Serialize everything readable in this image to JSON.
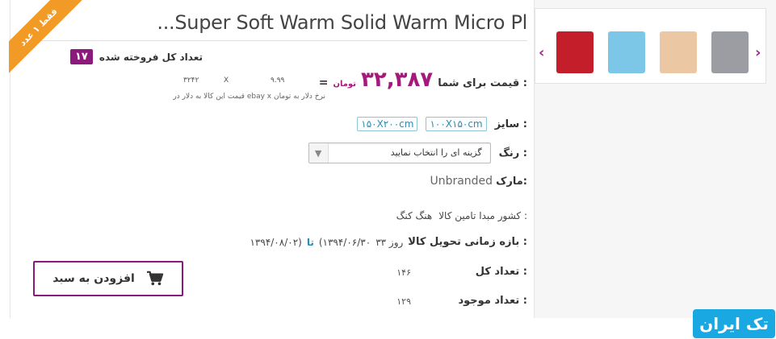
{
  "product": {
    "title": "...Super Soft Warm Solid Warm Micro Pl",
    "ribbon": "فقط ۱ عدد",
    "sold_label": "تعداد کل فروخته شده",
    "sold_count": "۱۷",
    "price_label": "قیمت برای شما :",
    "price_value": "۳۲,۳۸۷",
    "price_unit": "تومان",
    "price_dash": "=",
    "calc_rate": "۳۲۴۲",
    "calc_x": "X",
    "calc_usd": "۹.۹۹",
    "calc_note": "قیمت این کالا به دلار در ebay x نرخ دلار به تومان",
    "size_label": "سایز :",
    "sizes": [
      "۱۰۰X۱۵۰cm",
      "۱۵۰X۲۰۰cm"
    ],
    "color_label": "رنگ :",
    "color_select": "گزینه ای را انتخاب نمایید",
    "brand_label": "مارک:",
    "brand_value": "Unbranded",
    "origin_label": "کشور مبدا تامین کالا :",
    "origin_value": "هنگ کنگ",
    "delivery_label": "بازه زمانی تحویل کالا :",
    "delivery_days": "۳۳ روز",
    "delivery_from": "(۱۳۹۴/۰۶/۳۰",
    "delivery_to_word": "تا",
    "delivery_to": "۱۳۹۴/۰۸/۰۲)",
    "total_label": "تعداد کل :",
    "total_value": "۱۴۶",
    "stock_label": "تعداد موجود :",
    "stock_value": "۱۲۹",
    "cart_label": "افزودن به سبد"
  },
  "gallery": {
    "prev_arrow": "‹",
    "next_arrow": "›",
    "thumbs": [
      {
        "name": "thumb-red",
        "color": "#c41e2a"
      },
      {
        "name": "thumb-lightblue",
        "color": "#7cc6e8"
      },
      {
        "name": "thumb-beige",
        "color": "#ebc8a3"
      },
      {
        "name": "thumb-gray",
        "color": "#9c9da2"
      }
    ]
  },
  "footer": {
    "logo_text": "تک ایران"
  },
  "colors": {
    "accent": "#8b1a7a",
    "price": "#a6197c",
    "ribbon": "#f29a26",
    "link": "#2b8fb0",
    "logo": "#19a8e1"
  }
}
